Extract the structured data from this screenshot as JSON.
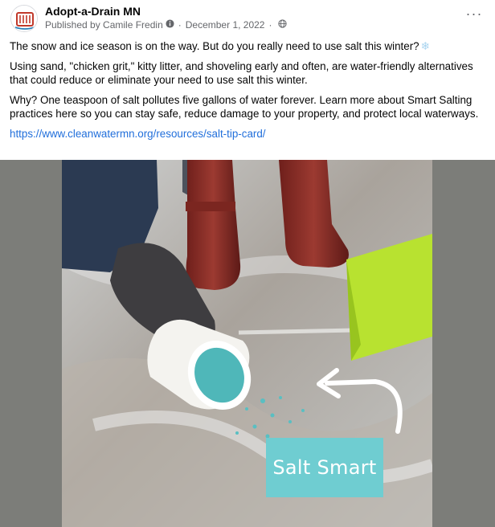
{
  "post": {
    "page_name": "Adopt-a-Drain MN",
    "published_by": "Published by Camile Fredin",
    "date": "December 1, 2022",
    "more_label": "···",
    "paragraphs": [
      "The snow and ice season is on the way. But do you really need to use salt this winter?",
      "Using sand, \"chicken grit,\" kitty litter, and shoveling early and often, are water-friendly alternatives that could reduce or eliminate your need to use salt this winter.",
      "Why? One teaspoon of salt pollutes five gallons of water forever. Learn more about Smart Salting practices here so you can stay safe, reduce damage to your property, and protect local waterways."
    ],
    "link": "https://www.cleanwatermn.org/resources/salt-tip-card/",
    "snowflake_glyph": "❄"
  },
  "photo": {
    "badge_text": "Salt Smart"
  },
  "icons": {
    "avatar": "adopt-a-drain-logo-icon",
    "publisher": "info-circle-icon",
    "audience": "globe-icon",
    "more": "more-options-icon"
  },
  "colors": {
    "link": "#216fdb",
    "secondary_text": "#65676b",
    "badge": "#6fcdd1",
    "letterbox": "#7c7d79"
  }
}
